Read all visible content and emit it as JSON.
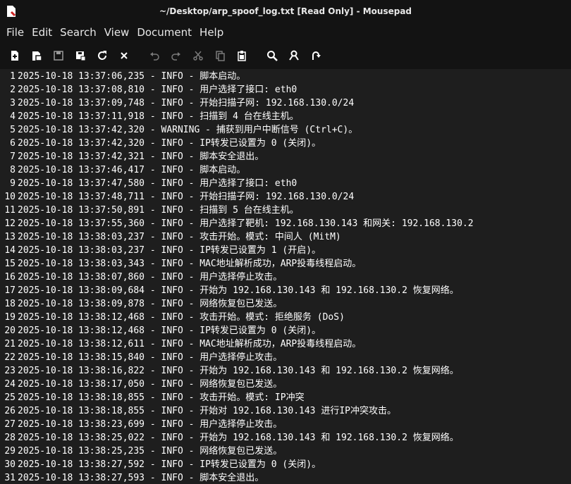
{
  "window": {
    "title": "~/Desktop/arp_spoof_log.txt [Read Only] - Mousepad"
  },
  "menu": [
    "File",
    "Edit",
    "Search",
    "View",
    "Document",
    "Help"
  ],
  "toolbar": {
    "buttons": [
      {
        "name": "new-document-button",
        "icon": "new-document-icon"
      },
      {
        "name": "new-window-button",
        "icon": "new-window-icon"
      },
      {
        "name": "save-button",
        "icon": "save-icon"
      },
      {
        "name": "save-as-button",
        "icon": "save-as-icon"
      },
      {
        "name": "reload-button",
        "icon": "reload-icon"
      },
      {
        "name": "close-button",
        "icon": "close-icon"
      },
      {
        "name": "undo-button",
        "icon": "undo-icon"
      },
      {
        "name": "redo-button",
        "icon": "redo-icon"
      },
      {
        "name": "cut-button",
        "icon": "cut-icon"
      },
      {
        "name": "copy-button",
        "icon": "copy-icon"
      },
      {
        "name": "paste-button",
        "icon": "paste-icon"
      },
      {
        "name": "find-button",
        "icon": "search-icon"
      },
      {
        "name": "replace-button",
        "icon": "find-replace-icon"
      },
      {
        "name": "go-to-line-button",
        "icon": "go-to-icon"
      }
    ]
  },
  "lines": [
    "2025-10-18 13:37:06,235 - INFO - 脚本启动。",
    "2025-10-18 13:37:08,810 - INFO - 用户选择了接口: eth0",
    "2025-10-18 13:37:09,748 - INFO - 开始扫描子网: 192.168.130.0/24",
    "2025-10-18 13:37:11,918 - INFO - 扫描到 4 台在线主机。",
    "2025-10-18 13:37:42,320 - WARNING - 捕获到用户中断信号 (Ctrl+C)。",
    "2025-10-18 13:37:42,320 - INFO - IP转发已设置为 0 (关闭)。",
    "2025-10-18 13:37:42,321 - INFO - 脚本安全退出。",
    "2025-10-18 13:37:46,417 - INFO - 脚本启动。",
    "2025-10-18 13:37:47,580 - INFO - 用户选择了接口: eth0",
    "2025-10-18 13:37:48,711 - INFO - 开始扫描子网: 192.168.130.0/24",
    "2025-10-18 13:37:50,891 - INFO - 扫描到 5 台在线主机。",
    "2025-10-18 13:37:55,360 - INFO - 用户选择了靶机: 192.168.130.143 和网关: 192.168.130.2",
    "2025-10-18 13:38:03,237 - INFO - 攻击开始。模式: 中间人 (MitM)",
    "2025-10-18 13:38:03,237 - INFO - IP转发已设置为 1 (开启)。",
    "2025-10-18 13:38:03,343 - INFO - MAC地址解析成功，ARP投毒线程启动。",
    "2025-10-18 13:38:07,860 - INFO - 用户选择停止攻击。",
    "2025-10-18 13:38:09,684 - INFO - 开始为 192.168.130.143 和 192.168.130.2 恢复网络。",
    "2025-10-18 13:38:09,878 - INFO - 网络恢复包已发送。",
    "2025-10-18 13:38:12,468 - INFO - 攻击开始。模式: 拒绝服务 (DoS)",
    "2025-10-18 13:38:12,468 - INFO - IP转发已设置为 0 (关闭)。",
    "2025-10-18 13:38:12,611 - INFO - MAC地址解析成功，ARP投毒线程启动。",
    "2025-10-18 13:38:15,840 - INFO - 用户选择停止攻击。",
    "2025-10-18 13:38:16,822 - INFO - 开始为 192.168.130.143 和 192.168.130.2 恢复网络。",
    "2025-10-18 13:38:17,050 - INFO - 网络恢复包已发送。",
    "2025-10-18 13:38:18,855 - INFO - 攻击开始。模式: IP冲突",
    "2025-10-18 13:38:18,855 - INFO - 开始对 192.168.130.143 进行IP冲突攻击。",
    "2025-10-18 13:38:23,699 - INFO - 用户选择停止攻击。",
    "2025-10-18 13:38:25,022 - INFO - 开始为 192.168.130.143 和 192.168.130.2 恢复网络。",
    "2025-10-18 13:38:25,235 - INFO - 网络恢复包已发送。",
    "2025-10-18 13:38:27,592 - INFO - IP转发已设置为 0 (关闭)。",
    "2025-10-18 13:38:27,593 - INFO - 脚本安全退出。"
  ]
}
